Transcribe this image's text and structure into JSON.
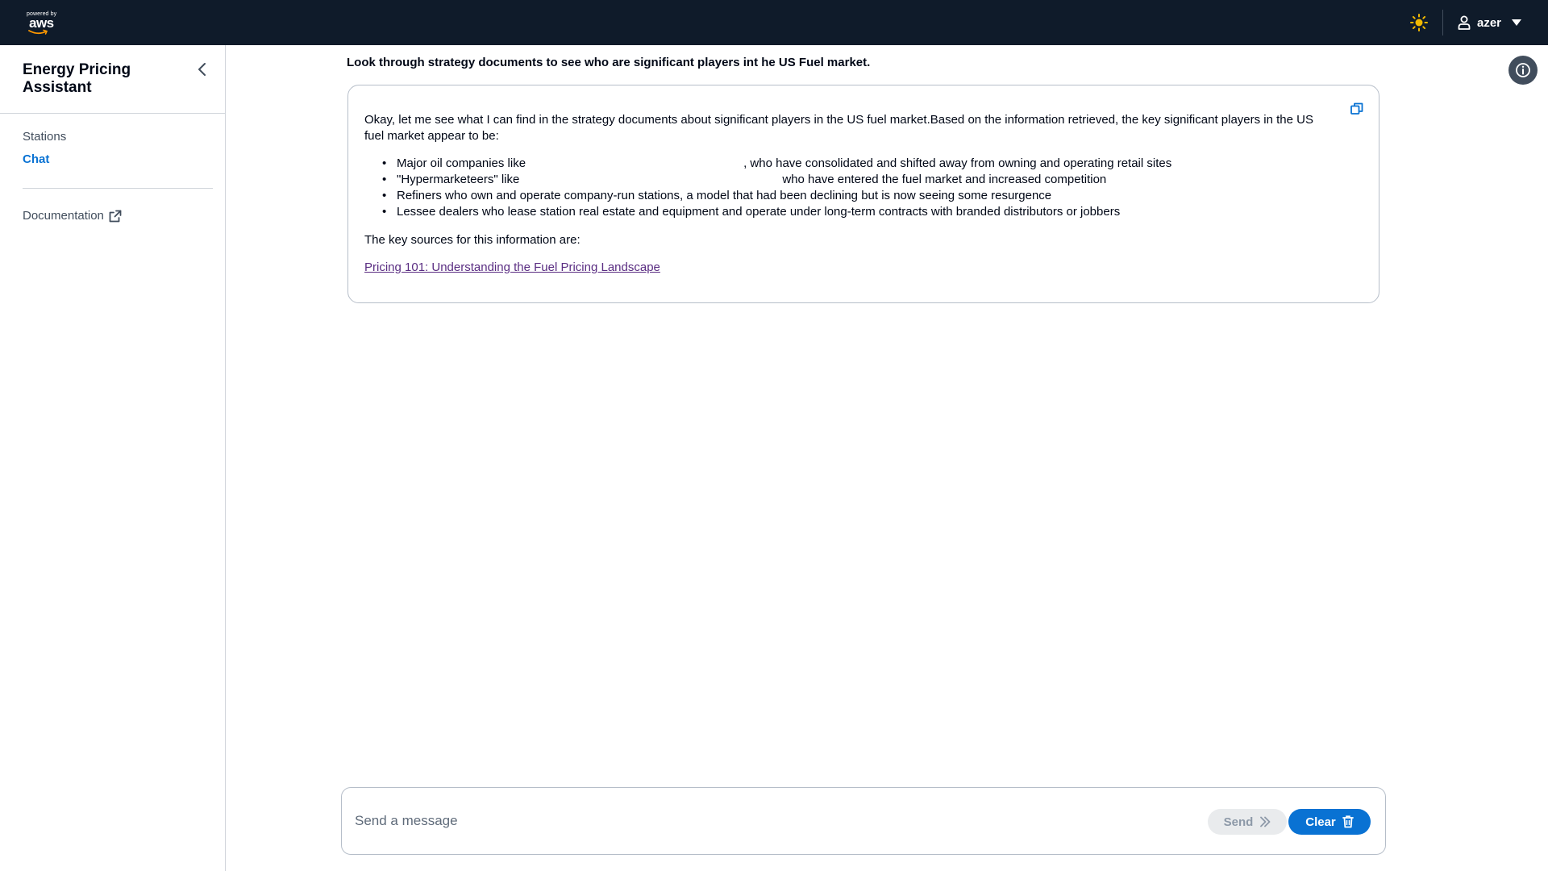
{
  "header": {
    "logo_small_text": "powered by",
    "logo_text": "aws",
    "username": "azer",
    "icons": {
      "theme": "sun-icon",
      "user": "user-icon",
      "dropdown": "caret-down-icon"
    },
    "colors": {
      "background": "#0f1b2a",
      "theme_icon": "#f2b900"
    }
  },
  "sidebar": {
    "title": "Energy Pricing Assistant",
    "items": [
      {
        "label": "Stations",
        "active": false
      },
      {
        "label": "Chat",
        "active": true
      }
    ],
    "documentation_label": "Documentation",
    "icons": {
      "collapse": "chevron-left-icon",
      "external": "external-link-icon"
    }
  },
  "chat": {
    "question": "Look through strategy documents to see who are significant players int he US Fuel market.",
    "answer": {
      "intro": "Okay, let me see what I can find in the strategy documents about significant players in the US fuel market.Based on the information retrieved, the key significant players in the US fuel market appear to be:",
      "bullets": [
        {
          "before": "Major oil companies like",
          "after": ", who have consolidated and shifted away from owning and operating retail sites"
        },
        {
          "before": "\"Hypermarketeers\" like",
          "after": "who have entered the fuel market and increased competition"
        },
        {
          "before": "Refiners who own and operate company-run stations, a model that had been declining but is now seeing some resurgence",
          "after": ""
        },
        {
          "before": "Lessee dealers who lease station real estate and equipment and operate under long-term contracts with branded distributors or jobbers",
          "after": ""
        }
      ],
      "sources_label": "The key sources for this information are:",
      "source_link": "Pricing 101: Understanding the Fuel Pricing Landscape"
    },
    "icons": {
      "copy": "copy-icon",
      "info": "info-icon"
    }
  },
  "composer": {
    "placeholder": "Send a message",
    "value": "",
    "send_label": "Send",
    "clear_label": "Clear",
    "icons": {
      "send": "double-chevron-right-icon",
      "clear": "trash-icon"
    },
    "colors": {
      "accent": "#0972d3"
    }
  }
}
